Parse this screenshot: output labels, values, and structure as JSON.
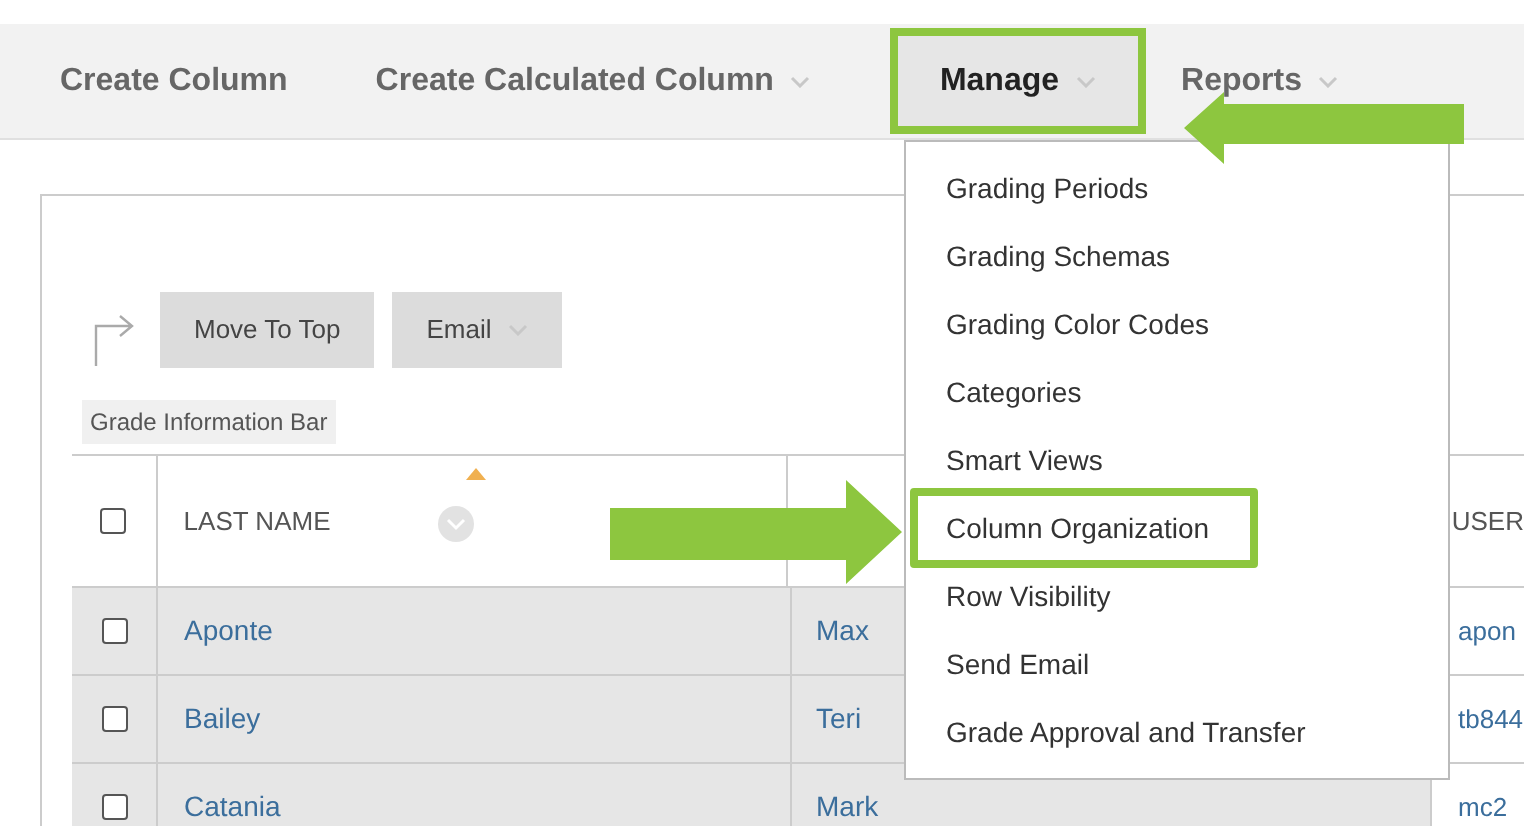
{
  "toolbar": {
    "items": [
      {
        "label": "Create Column",
        "has_menu": false,
        "selected": false
      },
      {
        "label": "Create Calculated Column",
        "has_menu": true,
        "selected": false
      },
      {
        "label": "Manage",
        "has_menu": true,
        "selected": true
      },
      {
        "label": "Reports",
        "has_menu": true,
        "selected": false
      }
    ]
  },
  "actions": [
    {
      "label": "Move To Top",
      "has_menu": false
    },
    {
      "label": "Email",
      "has_menu": true
    }
  ],
  "info_bar": "Grade Information Bar",
  "table": {
    "header": {
      "checked": false,
      "last_name": "LAST NAME",
      "column_4": "USER"
    },
    "rows": [
      {
        "checked": false,
        "last_name": "Aponte",
        "first_name": "Max",
        "column_4": "apon"
      },
      {
        "checked": false,
        "last_name": "Bailey",
        "first_name": "Teri",
        "column_4": "tb844"
      },
      {
        "checked": false,
        "last_name": "Catania",
        "first_name": "Mark",
        "column_4": "mc2"
      }
    ]
  },
  "menu": {
    "items": [
      {
        "label": "Grading Periods",
        "highlighted": false
      },
      {
        "label": "Grading Schemas",
        "highlighted": false
      },
      {
        "label": "Grading Color Codes",
        "highlighted": false
      },
      {
        "label": "Categories",
        "highlighted": false
      },
      {
        "label": "Smart Views",
        "highlighted": false
      },
      {
        "label": "Column Organization",
        "highlighted": true
      },
      {
        "label": "Row Visibility",
        "highlighted": false
      },
      {
        "label": "Send Email",
        "highlighted": false
      },
      {
        "label": "Grade Approval and Transfer",
        "highlighted": false
      }
    ]
  }
}
